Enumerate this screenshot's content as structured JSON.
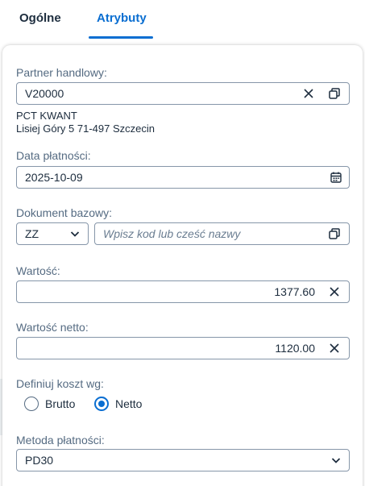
{
  "tabs": [
    {
      "label": "Ogólne",
      "active": false
    },
    {
      "label": "Atrybuty",
      "active": true
    }
  ],
  "partner": {
    "label": "Partner handlowy:",
    "value": "V20000",
    "name": "PCT KWANT",
    "address": "Lisiej Góry 5 71-497 Szczecin"
  },
  "payment_date": {
    "label": "Data płatności:",
    "value": "2025-10-09"
  },
  "base_document": {
    "label": "Dokument bazowy:",
    "type_value": "ZZ",
    "placeholder": "Wpisz kod lub cześć nazwy"
  },
  "value": {
    "label": "Wartość:",
    "value": "1377.60"
  },
  "net_value": {
    "label": "Wartość netto:",
    "value": "1120.00"
  },
  "cost_basis": {
    "label": "Definiuj koszt wg:",
    "options": [
      {
        "label": "Brutto",
        "selected": false
      },
      {
        "label": "Netto",
        "selected": true
      }
    ]
  },
  "payment_method": {
    "label": "Metoda płatności:",
    "value": "PD30"
  },
  "colors": {
    "accent": "#0a6ed1",
    "text": "#1d2d3e",
    "label": "#556b82",
    "border": "#8696a9"
  }
}
